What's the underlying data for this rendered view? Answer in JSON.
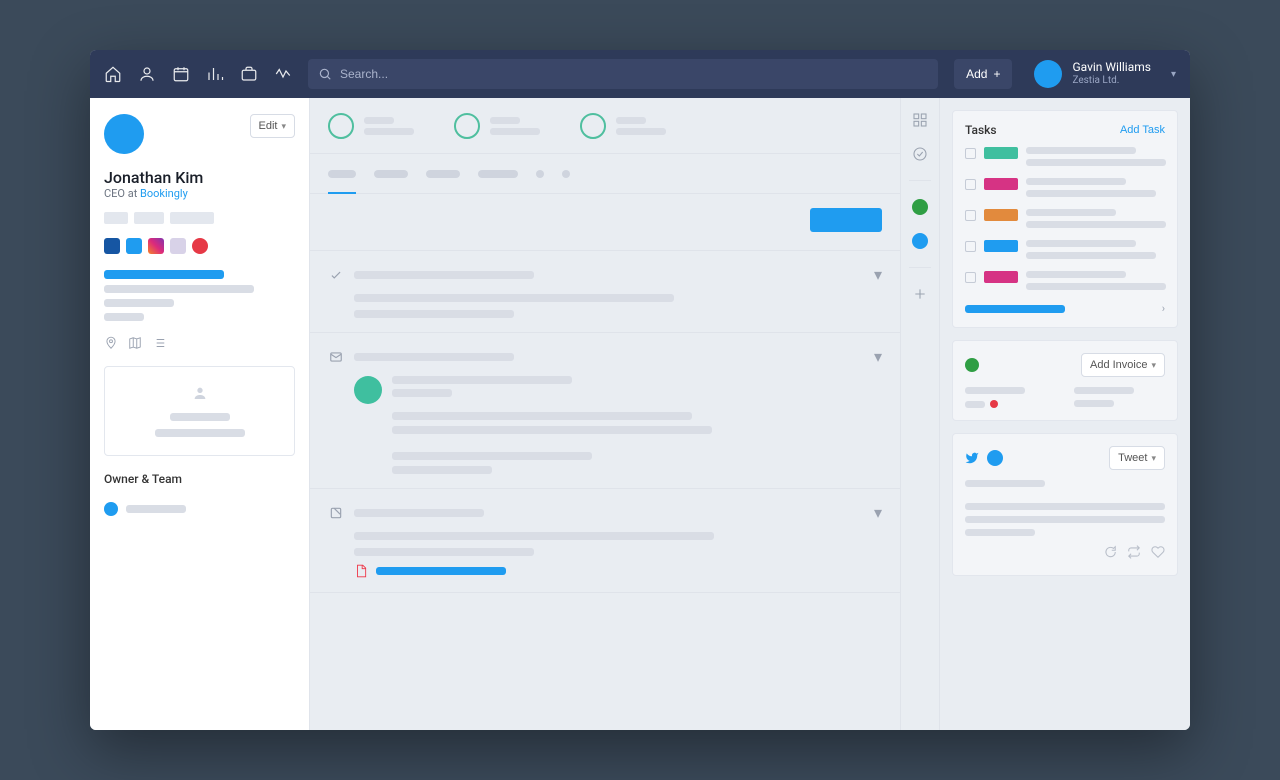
{
  "nav": {
    "search_placeholder": "Search...",
    "add_label": "Add"
  },
  "user": {
    "name": "Gavin Williams",
    "org": "Zestia Ltd."
  },
  "contact": {
    "name": "Jonathan Kim",
    "role_prefix": "CEO at ",
    "company": "Bookingly",
    "edit_label": "Edit"
  },
  "sidebar": {
    "owner_team_label": "Owner & Team"
  },
  "socials": {
    "colors": [
      "#1656a3",
      "#1f9cf0",
      "#e4405f",
      "#d8d2e8",
      "#e63946"
    ]
  },
  "tasks": {
    "title": "Tasks",
    "add_label": "Add Task",
    "items": [
      {
        "color": "#3fbf9f"
      },
      {
        "color": "#d63384"
      },
      {
        "color": "#e28a3d"
      },
      {
        "color": "#1f9cf0"
      },
      {
        "color": "#d63384"
      }
    ]
  },
  "invoice": {
    "add_label": "Add Invoice"
  },
  "twitter": {
    "tweet_label": "Tweet"
  },
  "colors": {
    "green": "#2f9e44",
    "blue": "#1f9cf0"
  }
}
